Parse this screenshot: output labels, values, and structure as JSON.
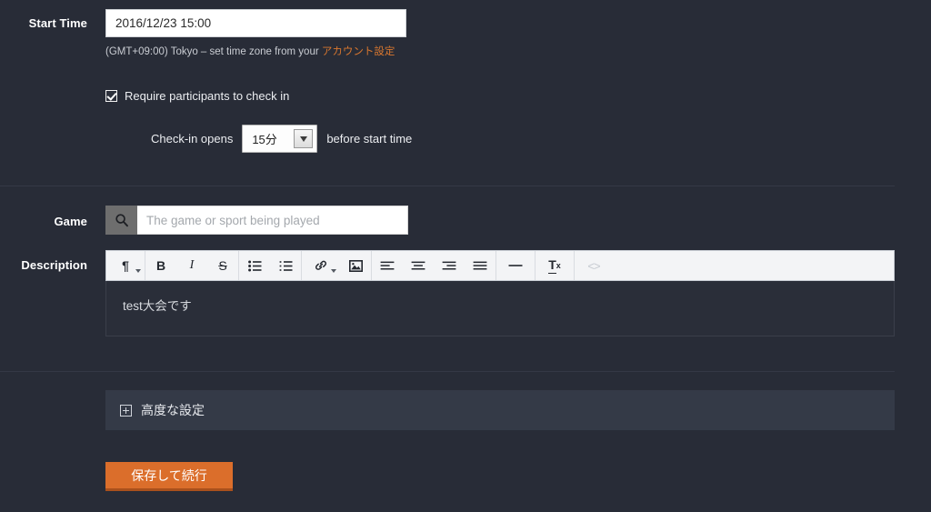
{
  "form": {
    "start_time": {
      "label": "Start Time",
      "value": "2016/12/23 15:00",
      "timezone_prefix": "(GMT+09:00) Tokyo – set time zone from your ",
      "timezone_link": "アカウント設定"
    },
    "checkin": {
      "checkbox_label": "Require participants to check in",
      "checked": true,
      "opens_label": "Check-in opens",
      "opens_value": "15分",
      "after_label": "before start time",
      "options": [
        "15分"
      ]
    },
    "game": {
      "label": "Game",
      "value": "",
      "placeholder": "The game or sport being played",
      "search_icon": "search-icon"
    },
    "description": {
      "label": "Description",
      "body_text": "test大会です",
      "toolbar": [
        {
          "name": "paragraph-format",
          "glyph": "¶",
          "caret": true,
          "dim": false
        },
        {
          "name": "bold",
          "glyph": "B",
          "caret": false,
          "dim": false
        },
        {
          "name": "italic",
          "glyph": "I",
          "caret": false,
          "dim": false
        },
        {
          "name": "strikethrough",
          "glyph": "S",
          "caret": false,
          "dim": false
        },
        {
          "name": "unordered-list",
          "glyph": "list-ul-icon",
          "caret": false,
          "dim": false
        },
        {
          "name": "ordered-list",
          "glyph": "list-ol-icon",
          "caret": false,
          "dim": false
        },
        {
          "name": "insert-link",
          "glyph": "link-icon",
          "caret": true,
          "dim": false
        },
        {
          "name": "insert-image",
          "glyph": "image-icon",
          "caret": false,
          "dim": false
        },
        {
          "name": "align-left",
          "glyph": "align-left-icon",
          "caret": false,
          "dim": false
        },
        {
          "name": "align-center",
          "glyph": "align-center-icon",
          "caret": false,
          "dim": false
        },
        {
          "name": "align-right",
          "glyph": "align-right-icon",
          "caret": false,
          "dim": false
        },
        {
          "name": "align-justify",
          "glyph": "align-justify-icon",
          "caret": false,
          "dim": false
        },
        {
          "name": "horizontal-rule",
          "glyph": "minus-icon",
          "caret": false,
          "dim": false
        },
        {
          "name": "clear-formatting",
          "glyph": "Tx",
          "caret": false,
          "dim": false
        },
        {
          "name": "code-view",
          "glyph": "<>",
          "caret": false,
          "dim": true
        }
      ]
    },
    "advanced": {
      "label": "高度な設定",
      "icon": "expand-plus-box-icon"
    },
    "save": {
      "label": "保存して続行"
    }
  },
  "colors": {
    "background": "#282c37",
    "panel": "#343a47",
    "accent": "#db6e2b",
    "link": "#d9772f",
    "divider": "#343845",
    "toolbar_bg": "#f3f4f6",
    "editor_body": "#2a2e39"
  }
}
